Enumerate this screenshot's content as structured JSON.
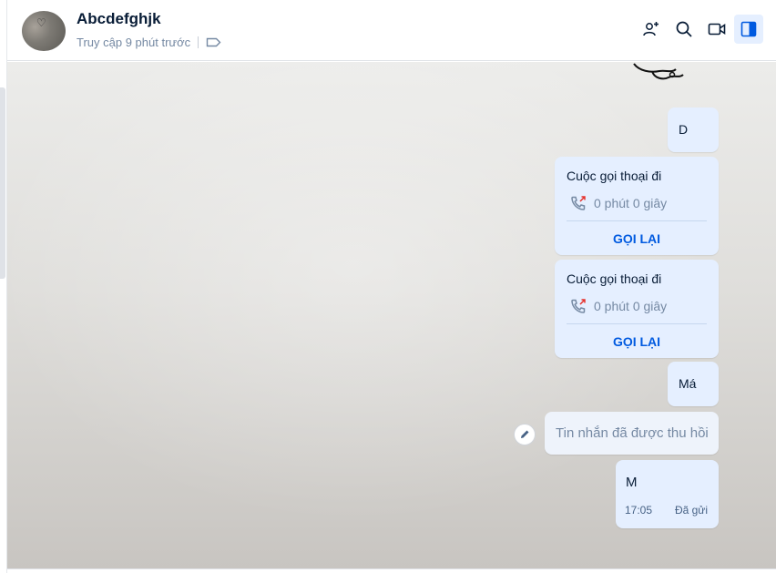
{
  "header": {
    "contact_name": "Abcdefghjk",
    "last_seen": "Truy cập 9 phút trước",
    "icons": [
      "add-user-group-icon",
      "search-icon",
      "video-call-icon",
      "sidebar-toggle-icon"
    ]
  },
  "messages": [
    {
      "type": "text",
      "text": "D"
    },
    {
      "type": "call",
      "title": "Cuộc gọi thoại đi",
      "duration": "0 phút 0 giây",
      "action": "GỌI LẠI"
    },
    {
      "type": "call",
      "title": "Cuộc gọi thoại đi",
      "duration": "0 phút 0 giây",
      "action": "GỌI LẠI"
    },
    {
      "type": "text",
      "text": "Má"
    },
    {
      "type": "recalled",
      "text": "Tin nhắn đã được thu hồi"
    },
    {
      "type": "text",
      "text": "M",
      "time": "17:05",
      "status": "Đã gửi"
    }
  ],
  "colors": {
    "bubble": "#e5efff",
    "accent": "#005ae0",
    "muted": "#7589a3",
    "missed_call": "#e5322d"
  }
}
